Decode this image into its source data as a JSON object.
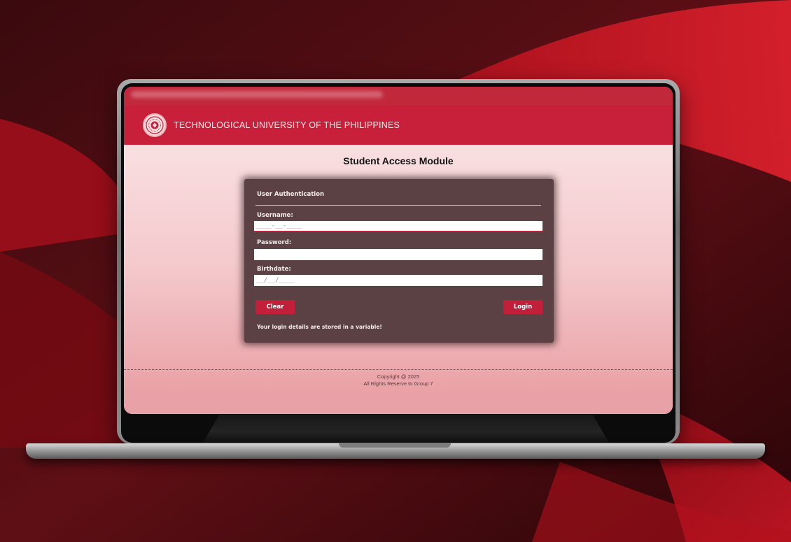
{
  "header": {
    "university_name": "TECHNOLOGICAL UNIVERSITY OF THE PHILIPPINES"
  },
  "page": {
    "title": "Student Access Module"
  },
  "auth_card": {
    "title": "User Authentication",
    "username": {
      "label": "Username:",
      "placeholder": "____-__-____",
      "value": ""
    },
    "password": {
      "label": "Password:",
      "value": ""
    },
    "birthdate": {
      "label": "Birthdate:",
      "placeholder": "__/__/____",
      "value": ""
    },
    "clear_label": "Clear",
    "login_label": "Login",
    "note": "Your login details are stored in a variable!"
  },
  "footer": {
    "copyright": "Copyright @ 2025",
    "rights": "All Rights Reserve to Group 7"
  },
  "colors": {
    "brand_red": "#c8203a",
    "card_bg": "#5c4144",
    "page_gradient_top": "#fbe9ea",
    "page_gradient_bottom": "#e89a9f"
  },
  "icons": {
    "logo": "university-seal-icon"
  }
}
